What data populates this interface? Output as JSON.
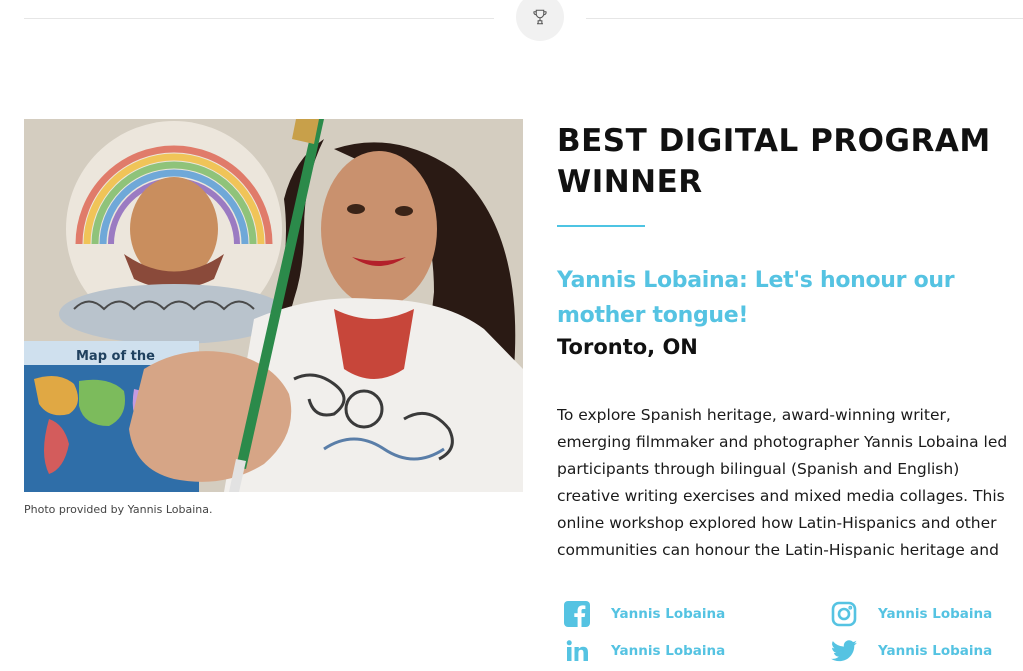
{
  "award": {
    "title": "BEST DIGITAL PROGRAM WINNER"
  },
  "photo": {
    "caption": "Photo provided by Yannis Lobaina.",
    "map_label": "Map of the"
  },
  "project": {
    "title": "Yannis Lobaina: Let's honour our mother tongue!",
    "location": "Toronto, ON",
    "description": "To explore Spanish heritage, award-winning writer, emerging filmmaker and photographer Yannis Lobaina led participants through bilingual (Spanish and English) creative writing exercises and mixed media collages. This online workshop explored how Latin-Hispanics and other communities can honour the Latin-Hispanic heritage and their mother tongue."
  },
  "social": {
    "facebook": {
      "icon": "facebook-icon",
      "label": "Yannis Lobaina"
    },
    "instagram": {
      "icon": "instagram-icon",
      "label": "Yannis Lobaina"
    },
    "linkedin": {
      "icon": "linkedin-icon",
      "label": "Yannis Lobaina"
    },
    "twitter": {
      "icon": "twitter-icon",
      "label": "Yannis Lobaina"
    }
  },
  "colors": {
    "accent": "#55c3e2",
    "heading": "#111111",
    "divider": "#e6e6e6"
  }
}
